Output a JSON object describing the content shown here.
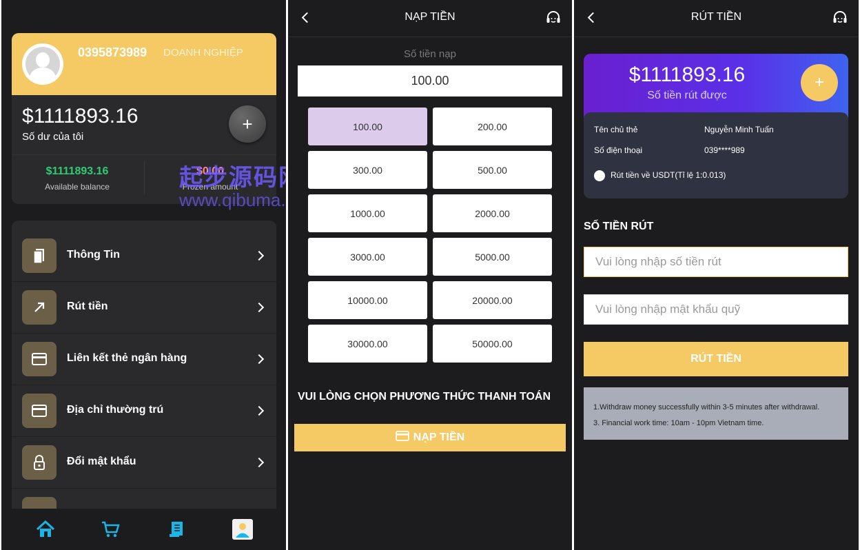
{
  "profile": {
    "phone": "0395873989",
    "account_type": "DOANH NGHIỆP",
    "balance": "$1111893.16",
    "balance_label": "Số dư của tôi",
    "plus": "+",
    "available_value": "$1111893.16",
    "available_label": "Available balance",
    "frozen_value": "$0.00",
    "frozen_label": "Frozen amount"
  },
  "menu": [
    {
      "label": "Thông Tin",
      "icon": "bookmark-icon"
    },
    {
      "label": "Rút tiền",
      "icon": "arrow-up-right-icon"
    },
    {
      "label": "Liên kết thẻ ngân hàng",
      "icon": "card-icon"
    },
    {
      "label": "Địa chỉ thường trú",
      "icon": "card-icon"
    },
    {
      "label": "Đổi mật khẩu",
      "icon": "lock-icon"
    }
  ],
  "tabbar": [
    "home-icon",
    "cart-icon",
    "document-icon",
    "profile-icon"
  ],
  "watermark": {
    "line1": "起步源码网",
    "line2": "www.qibuma.com"
  },
  "deposit": {
    "title": "NẠP TIỀN",
    "amount_label": "Số tiền nạp",
    "amount_value": "100.00",
    "options": [
      "100.00",
      "200.00",
      "300.00",
      "500.00",
      "1000.00",
      "2000.00",
      "3000.00",
      "5000.00",
      "10000.00",
      "20000.00",
      "30000.00",
      "50000.00"
    ],
    "selected": "100.00",
    "payment_label": "VUI LÒNG CHỌN PHƯƠNG THỨC THANH TOÁN",
    "submit": "NẠP TIỀN"
  },
  "withdraw": {
    "title": "RÚT TIỀN",
    "amount": "$1111893.16",
    "amount_label": "Số tiền rút được",
    "plus": "+",
    "holder_label": "Tên chủ thẻ",
    "holder_value": "Nguyễn Minh Tuấn",
    "phone_label": "Số điện thoại",
    "phone_value": "039****989",
    "usdt_label": "Rút tiền về USDT(Tỉ lệ 1:0.013)",
    "section_title": "SỐ TIỀN RÚT",
    "amount_placeholder": "Vui lòng nhập số tiền rút",
    "password_placeholder": "Vui lòng nhập mật khẩu quỹ",
    "submit": "RÚT TIỀN",
    "note1": "1.Withdraw money successfully within 3-5 minutes after withdrawal.",
    "note2": "3. Financial work time: 10am - 10pm Vietnam time."
  },
  "colors": {
    "accent": "#f5c964",
    "bg": "#1c1c1e",
    "card": "#2a2a2d",
    "selected": "#dccbea",
    "green": "#2ecc71"
  }
}
